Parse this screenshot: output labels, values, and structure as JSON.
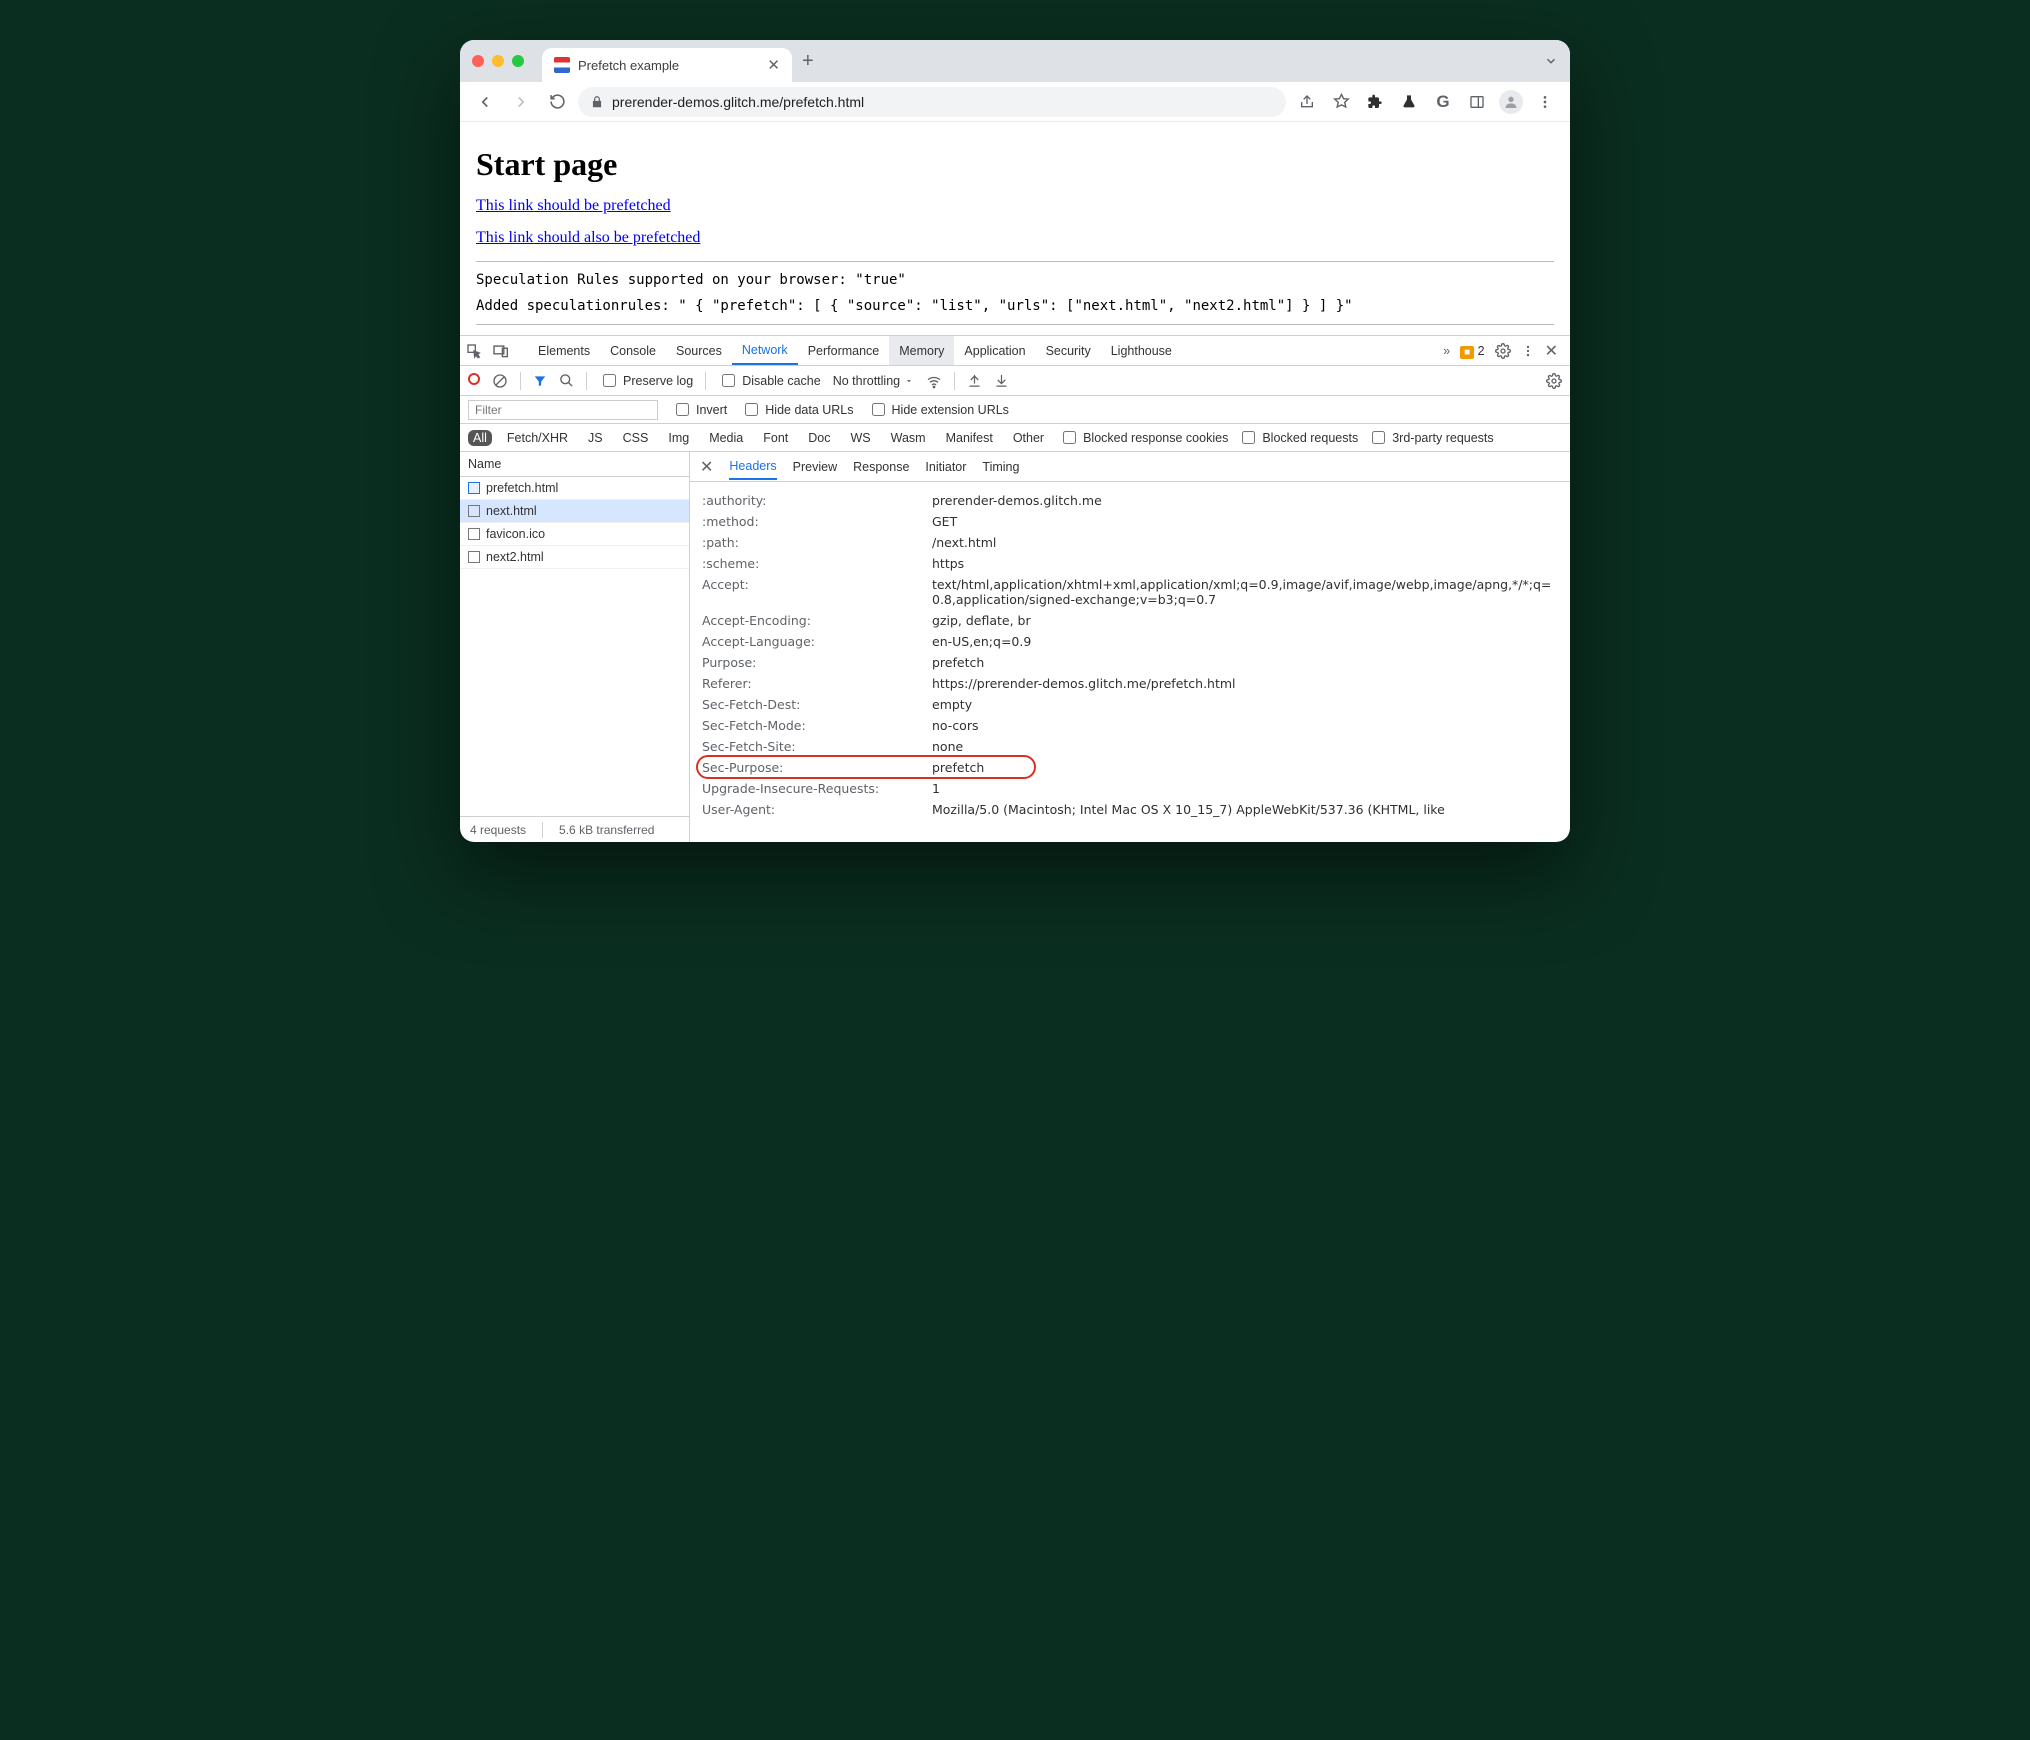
{
  "window": {
    "tab_title": "Prefetch example",
    "url": "prerender-demos.glitch.me/prefetch.html"
  },
  "page": {
    "heading": "Start page",
    "link1": "This link should be prefetched",
    "link2": "This link should also be prefetched",
    "status_line": "Speculation Rules supported on your browser: \"true\"",
    "rules_line": "Added speculationrules: \" { \"prefetch\": [ { \"source\": \"list\", \"urls\": [\"next.html\", \"next2.html\"] } ] }\""
  },
  "devtools": {
    "panels": [
      "Elements",
      "Console",
      "Sources",
      "Network",
      "Performance",
      "Memory",
      "Application",
      "Security",
      "Lighthouse"
    ],
    "active_panel": "Network",
    "highlighted_panel": "Memory",
    "warnings_count": "2",
    "netbar": {
      "preserve_log": "Preserve log",
      "disable_cache": "Disable cache",
      "throttling": "No throttling"
    },
    "filterbar": {
      "filter_placeholder": "Filter",
      "invert": "Invert",
      "hide_data": "Hide data URLs",
      "hide_ext": "Hide extension URLs"
    },
    "types": [
      "All",
      "Fetch/XHR",
      "JS",
      "CSS",
      "Img",
      "Media",
      "Font",
      "Doc",
      "WS",
      "Wasm",
      "Manifest",
      "Other"
    ],
    "type_checks": {
      "blocked_cookies": "Blocked response cookies",
      "blocked_req": "Blocked requests",
      "third_party": "3rd-party requests"
    },
    "reqlist_header": "Name",
    "requests": [
      {
        "name": "prefetch.html",
        "icon": "doc"
      },
      {
        "name": "next.html",
        "icon": "blank",
        "selected": true
      },
      {
        "name": "favicon.ico",
        "icon": "blank"
      },
      {
        "name": "next2.html",
        "icon": "blank"
      }
    ],
    "detail_tabs": [
      "Headers",
      "Preview",
      "Response",
      "Initiator",
      "Timing"
    ],
    "detail_active": "Headers",
    "headers": [
      {
        "k": ":authority:",
        "v": "prerender-demos.glitch.me"
      },
      {
        "k": ":method:",
        "v": "GET"
      },
      {
        "k": ":path:",
        "v": "/next.html"
      },
      {
        "k": ":scheme:",
        "v": "https"
      },
      {
        "k": "Accept:",
        "v": "text/html,application/xhtml+xml,application/xml;q=0.9,image/avif,image/webp,image/apng,*/*;q=0.8,application/signed-exchange;v=b3;q=0.7"
      },
      {
        "k": "Accept-Encoding:",
        "v": "gzip, deflate, br"
      },
      {
        "k": "Accept-Language:",
        "v": "en-US,en;q=0.9"
      },
      {
        "k": "Purpose:",
        "v": "prefetch"
      },
      {
        "k": "Referer:",
        "v": "https://prerender-demos.glitch.me/prefetch.html"
      },
      {
        "k": "Sec-Fetch-Dest:",
        "v": "empty"
      },
      {
        "k": "Sec-Fetch-Mode:",
        "v": "no-cors"
      },
      {
        "k": "Sec-Fetch-Site:",
        "v": "none"
      },
      {
        "k": "Sec-Purpose:",
        "v": "prefetch",
        "highlight": true
      },
      {
        "k": "Upgrade-Insecure-Requests:",
        "v": "1"
      },
      {
        "k": "User-Agent:",
        "v": "Mozilla/5.0 (Macintosh; Intel Mac OS X 10_15_7) AppleWebKit/537.36 (KHTML, like"
      }
    ],
    "status": {
      "requests": "4 requests",
      "transferred": "5.6 kB transferred"
    }
  }
}
